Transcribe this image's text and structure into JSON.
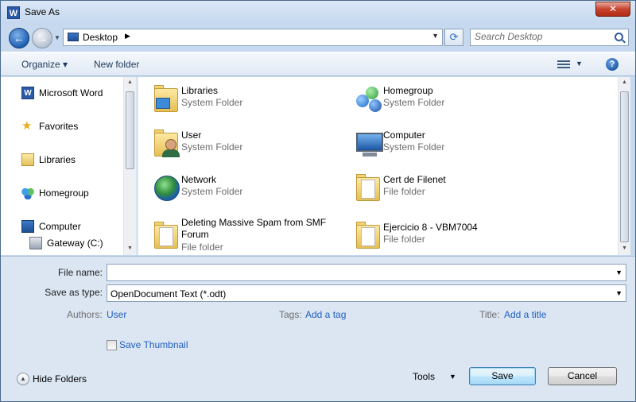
{
  "window": {
    "title": "Save As",
    "app_icon_glyph": "W",
    "close_glyph": "✕"
  },
  "address": {
    "location": "Desktop",
    "search_placeholder": "Search Desktop"
  },
  "toolbar": {
    "organize_label": "Organize ▾",
    "new_folder_label": "New folder",
    "help_glyph": "?"
  },
  "nav": {
    "items": [
      {
        "label": "Microsoft Word",
        "icon": "word-icon"
      },
      {
        "label": "Favorites",
        "icon": "star-icon"
      },
      {
        "label": "Libraries",
        "icon": "library-icon"
      },
      {
        "label": "Homegroup",
        "icon": "homegroup-icon"
      },
      {
        "label": "Computer",
        "icon": "computer-icon"
      },
      {
        "label": "Gateway (C:)",
        "icon": "drive-icon"
      }
    ]
  },
  "files": [
    {
      "name": "Libraries",
      "type": "System Folder",
      "icon": "libraries-icon"
    },
    {
      "name": "Homegroup",
      "type": "System Folder",
      "icon": "homegroup-icon"
    },
    {
      "name": "User",
      "type": "System Folder",
      "icon": "user-folder-icon"
    },
    {
      "name": "Computer",
      "type": "System Folder",
      "icon": "computer-icon"
    },
    {
      "name": "Network",
      "type": "System Folder",
      "icon": "network-icon"
    },
    {
      "name": "Cert de Filenet",
      "type": "File folder",
      "icon": "folder-icon"
    },
    {
      "name": "Deleting Massive Spam from SMF Forum",
      "type": "File folder",
      "icon": "folder-icon"
    },
    {
      "name": "Ejercicio 8 - VBM7004",
      "type": "File folder",
      "icon": "folder-icon"
    }
  ],
  "form": {
    "file_name_label": "File name:",
    "file_name_value": "",
    "save_type_label": "Save as type:",
    "save_type_value": "OpenDocument Text (*.odt)",
    "authors_label": "Authors:",
    "authors_value": "User",
    "tags_label": "Tags:",
    "tags_value": "Add a tag",
    "title_label": "Title:",
    "title_value": "Add a title",
    "thumbnail_label": "Save Thumbnail",
    "thumbnail_checked": false
  },
  "bottom": {
    "hide_folders_label": "Hide Folders",
    "tools_label": "Tools",
    "save_label": "Save",
    "cancel_label": "Cancel"
  }
}
